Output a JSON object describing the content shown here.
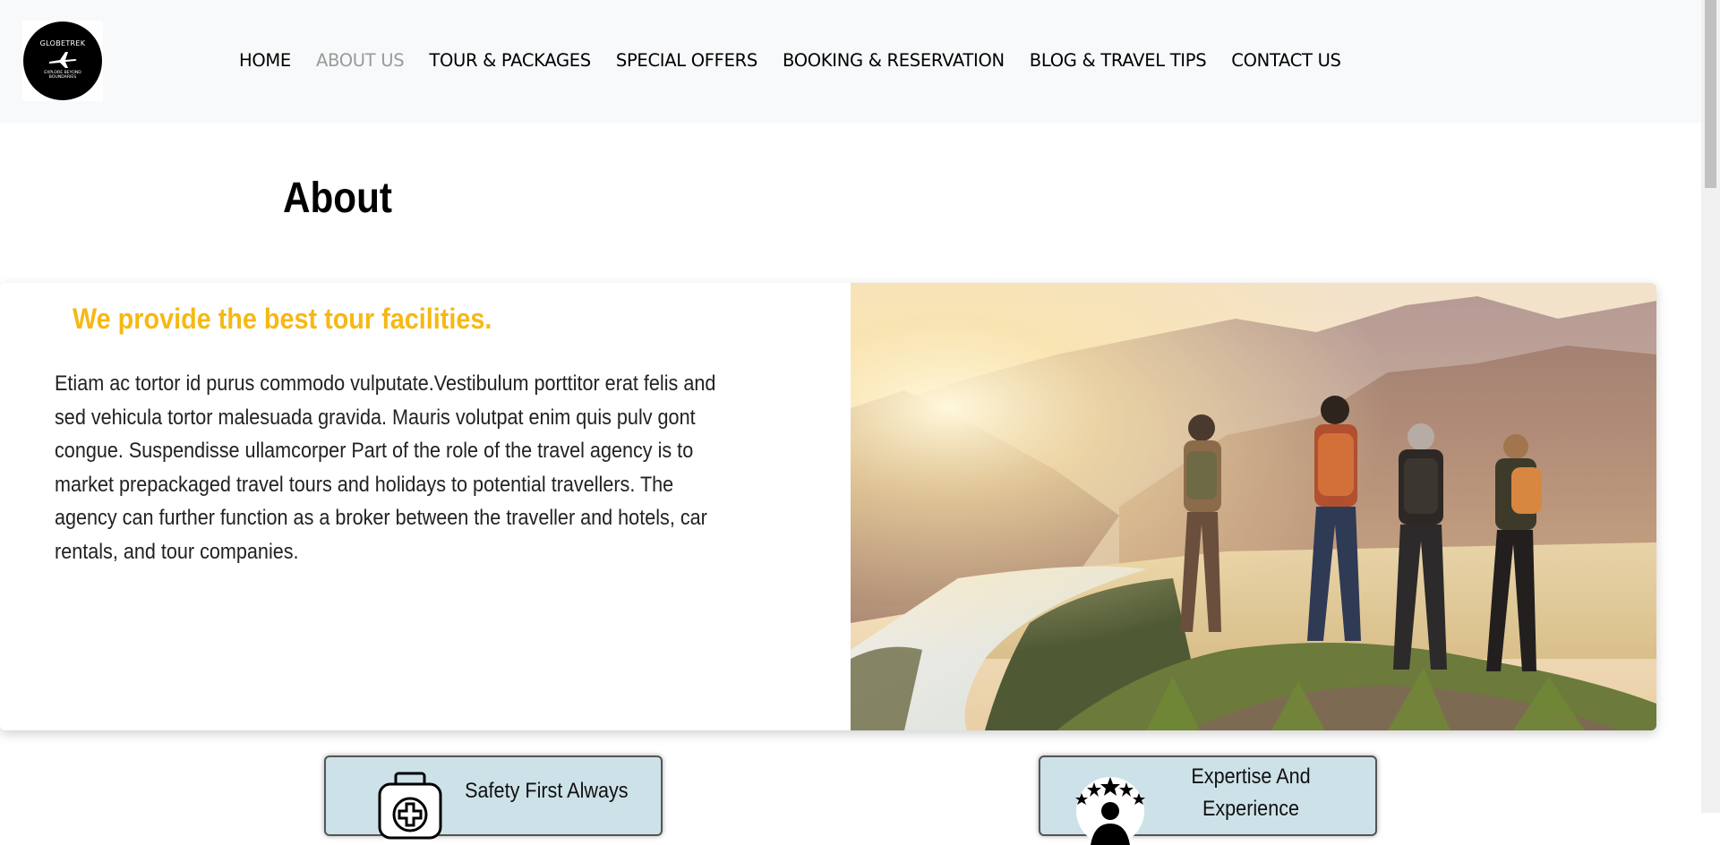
{
  "brand": {
    "name": "GLOBETREK",
    "tagline": "EXPLORE BEYOND BOUNDARIES"
  },
  "nav": {
    "items": [
      {
        "label": "HOME"
      },
      {
        "label": "ABOUT US",
        "active": true
      },
      {
        "label": "TOUR & PACKAGES"
      },
      {
        "label": "SPECIAL OFFERS"
      },
      {
        "label": "BOOKING & RESERVATION"
      },
      {
        "label": "BLOG & TRAVEL TIPS"
      },
      {
        "label": "CONTACT US"
      }
    ]
  },
  "page": {
    "title": "About"
  },
  "about": {
    "heading": "We provide the best tour facilities.",
    "body": "Etiam ac tortor id purus commodo vulputate.Vestibulum porttitor erat felis and sed vehicula tortor malesuada gravida. Mauris volutpat enim quis pulv gont congue. Suspendisse ullamcorper Part of the role of the travel agency is to market prepackaged travel tours and holidays to potential travellers. The agency can further function as a broker between the traveller and hotels, car rentals, and tour companies."
  },
  "features": [
    {
      "label": "Safety First Always",
      "icon": "first-aid-kit-icon"
    },
    {
      "label": "Expertise And Experience",
      "icon": "expert-rating-icon"
    }
  ],
  "colors": {
    "navbar_bg": "#f8f9fa",
    "accent_heading": "#f5b915",
    "nav_active": "#9a9a9a",
    "feature_card_bg": "#cde2e8"
  }
}
